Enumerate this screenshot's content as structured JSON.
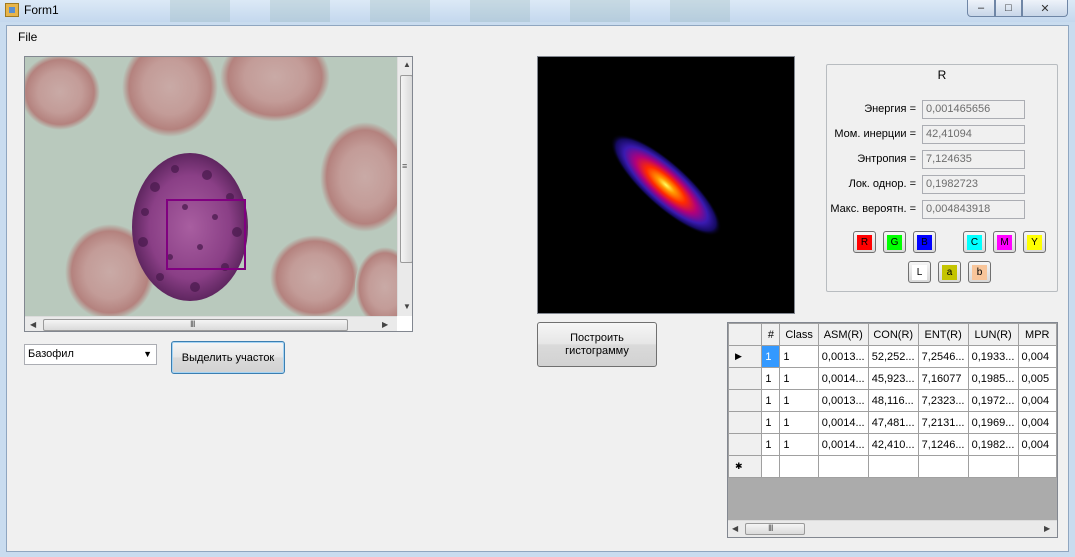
{
  "window": {
    "title": "Form1",
    "minimize_label": "–",
    "maximize_label": "□",
    "close_label": "✕"
  },
  "menu": {
    "file": "File"
  },
  "class_select": {
    "value": "Базофил"
  },
  "buttons": {
    "select_region": "Выделить участок",
    "build_histogram_line1": "Построить",
    "build_histogram_line2": "гистограмму"
  },
  "features": {
    "title": "R",
    "items": [
      {
        "label": "Энергия =",
        "value": "0,001465656"
      },
      {
        "label": "Мом. инерции =",
        "value": "42,41094"
      },
      {
        "label": "Энтропия =",
        "value": "7,124635"
      },
      {
        "label": "Лок. однор. =",
        "value": "0,1982723"
      },
      {
        "label": "Макс. вероятн. =",
        "value": "0,004843918"
      }
    ]
  },
  "channels": [
    {
      "label": "R",
      "color": "#ff0000"
    },
    {
      "label": "G",
      "color": "#00ff00"
    },
    {
      "label": "B",
      "color": "#0000ff"
    },
    {
      "label": "C",
      "color": "#00ffff"
    },
    {
      "label": "M",
      "color": "#ff00ff"
    },
    {
      "label": "Y",
      "color": "#ffff00"
    },
    {
      "label": "L",
      "color": "#ffffff"
    },
    {
      "label": "a",
      "color": "#c4c400"
    },
    {
      "label": "b",
      "color": "#f8c59a"
    }
  ],
  "grid": {
    "columns": [
      "#",
      "Class",
      "ASM(R)",
      "CON(R)",
      "ENT(R)",
      "LUN(R)",
      "MPR"
    ],
    "rows": [
      [
        "1",
        "1",
        "0,0013...",
        "52,252...",
        "7,2546...",
        "0,1933...",
        "0,004"
      ],
      [
        "1",
        "1",
        "0,0014...",
        "45,923...",
        "7,16077",
        "0,1985...",
        "0,005"
      ],
      [
        "1",
        "1",
        "0,0013...",
        "48,116...",
        "7,2323...",
        "0,1972...",
        "0,004"
      ],
      [
        "1",
        "1",
        "0,0014...",
        "47,481...",
        "7,2131...",
        "0,1969...",
        "0,004"
      ],
      [
        "1",
        "1",
        "0,0014...",
        "42,410...",
        "7,1246...",
        "0,1982...",
        "0,004"
      ]
    ],
    "current_row_marker": "▶",
    "new_row_marker": "✱"
  },
  "scrollbar_grip": "III"
}
